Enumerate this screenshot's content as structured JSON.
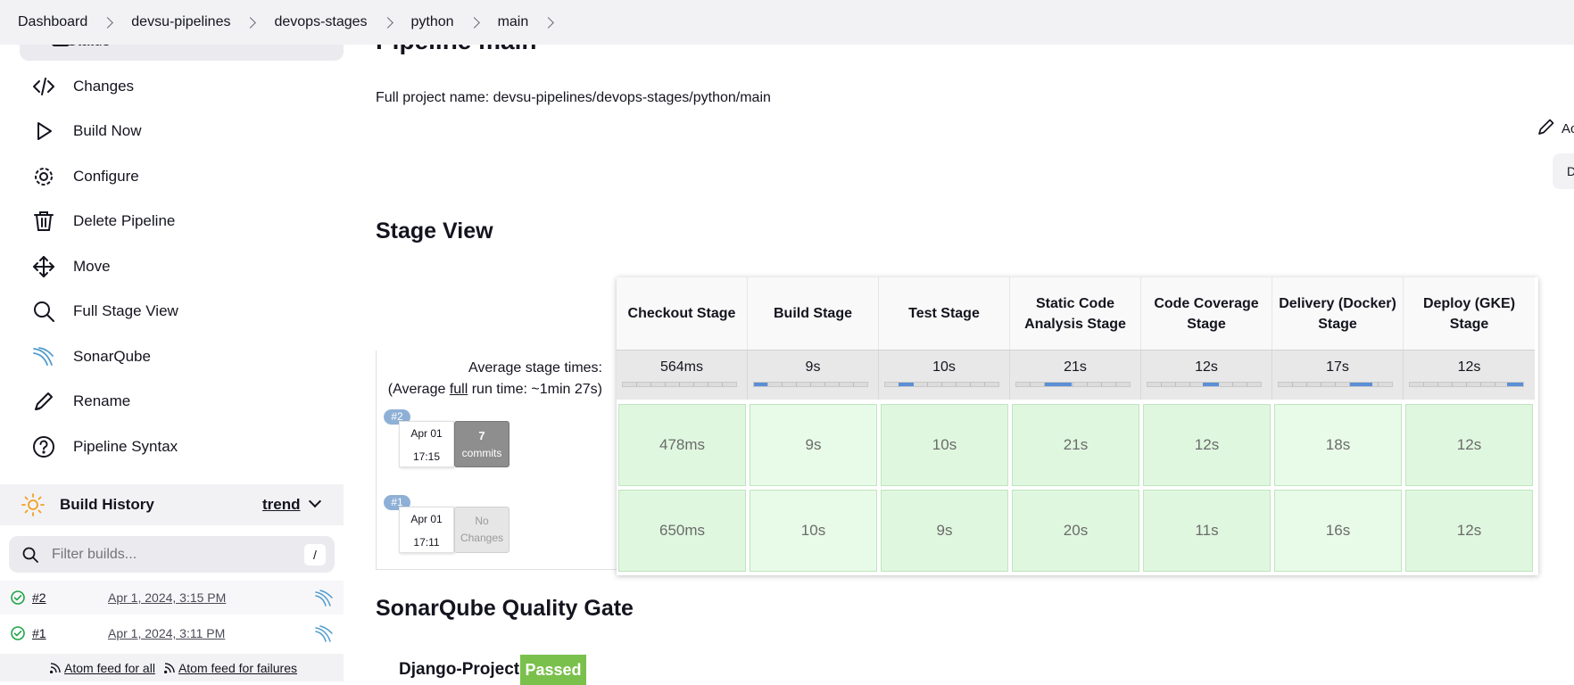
{
  "breadcrumb": [
    "Dashboard",
    "devsu-pipelines",
    "devops-stages",
    "python",
    "main"
  ],
  "sidebar": {
    "status_label": "Status",
    "tasks": [
      {
        "label": "Changes",
        "icon": "code-icon"
      },
      {
        "label": "Build Now",
        "icon": "play-icon"
      },
      {
        "label": "Configure",
        "icon": "gear-icon"
      },
      {
        "label": "Delete Pipeline",
        "icon": "trash-icon"
      },
      {
        "label": "Move",
        "icon": "move-icon"
      },
      {
        "label": "Full Stage View",
        "icon": "search-icon"
      },
      {
        "label": "SonarQube",
        "icon": "sonarqube-icon"
      },
      {
        "label": "Rename",
        "icon": "pencil-icon"
      },
      {
        "label": "Pipeline Syntax",
        "icon": "help-icon"
      }
    ],
    "build_history": {
      "title": "Build History",
      "trend": "trend",
      "filter_placeholder": "Filter builds...",
      "filter_shortcut": "/",
      "builds": [
        {
          "number": "#2",
          "date": "Apr 1, 2024, 3:15 PM",
          "status": "success"
        },
        {
          "number": "#1",
          "date": "Apr 1, 2024, 3:11 PM",
          "status": "success"
        }
      ],
      "feed_all": "Atom feed for all",
      "feed_failures": "Atom feed for failures"
    }
  },
  "main": {
    "title": "Pipeline main",
    "full_name": "Full project name: devsu-pipelines/devops-stages/python/main",
    "edit_label": "Ac",
    "side_tab": "D"
  },
  "stage_view": {
    "title": "Stage View",
    "avg_label_line1": "Average stage times:",
    "avg_label_pre": "(Average ",
    "avg_label_link": "full",
    "avg_label_post": " run time: ~1min 27s)",
    "stages": [
      {
        "name": "Checkout Stage",
        "avg": "564ms",
        "bar": 0.0
      },
      {
        "name": "Build Stage",
        "avg": "9s",
        "bar": 0.12
      },
      {
        "name": "Test Stage",
        "avg": "10s",
        "bar": 0.13
      },
      {
        "name": "Static Code Analysis Stage",
        "avg": "21s",
        "bar": 0.24
      },
      {
        "name": "Code Coverage Stage",
        "avg": "12s",
        "bar": 0.14
      },
      {
        "name": "Delivery (Docker) Stage",
        "avg": "17s",
        "bar": 0.2
      },
      {
        "name": "Deploy (GKE) Stage",
        "avg": "12s",
        "bar": 0.14
      }
    ],
    "runs": [
      {
        "badge": "#2",
        "date": "Apr 01",
        "time": "17:15",
        "commits_count": "7",
        "commits_label": "commits",
        "changes": true,
        "durations": [
          "478ms",
          "9s",
          "10s",
          "21s",
          "12s",
          "18s",
          "12s"
        ]
      },
      {
        "badge": "#1",
        "date": "Apr 01",
        "time": "17:11",
        "commits_count": "No",
        "commits_label": "Changes",
        "changes": false,
        "durations": [
          "650ms",
          "10s",
          "9s",
          "20s",
          "11s",
          "16s",
          "12s"
        ]
      }
    ]
  },
  "sonarqube": {
    "title": "SonarQube Quality Gate",
    "project": "Django-Project",
    "status": "Passed"
  },
  "colors": {
    "success_cell": "#dff7df",
    "passed": "#7ac04c",
    "progress": "#5b8fd6"
  }
}
